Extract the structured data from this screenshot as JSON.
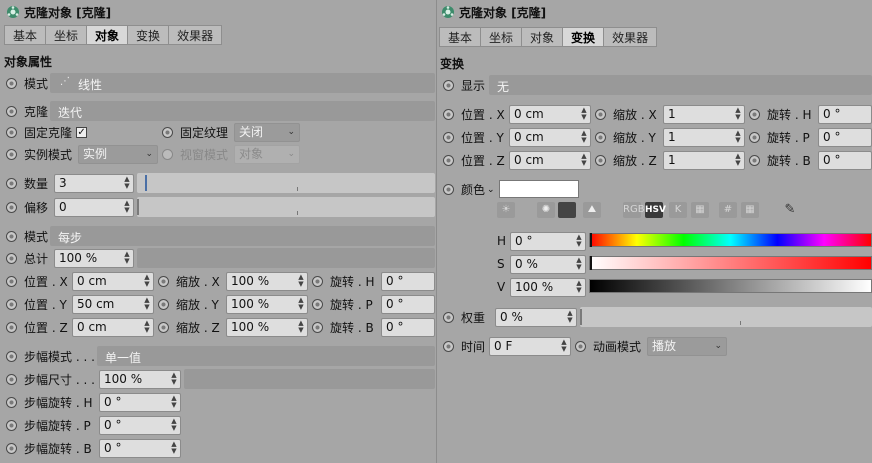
{
  "left": {
    "title": "克隆对象 [克隆]",
    "tabs": [
      "基本",
      "坐标",
      "对象",
      "变换",
      "效果器"
    ],
    "active_tab": "对象",
    "section": "对象属性",
    "mode_label": "模式",
    "mode_value": "线性",
    "clone_label": "克隆",
    "clone_value": "迭代",
    "fix_clone_label": "固定克隆",
    "fix_texture_label": "固定纹理",
    "fix_texture_value": "关闭",
    "instance_mode_label": "实例模式",
    "instance_mode_value": "实例",
    "viewport_mode_label": "视窗模式",
    "viewport_mode_value": "对象",
    "count_label": "数量",
    "count_value": "3",
    "offset_label": "偏移",
    "offset_value": "0",
    "mode2_label": "模式",
    "mode2_value": "每步",
    "total_label": "总计",
    "total_value": "100 %",
    "pos_x_label": "位置 . X",
    "pos_x_value": "0 cm",
    "pos_y_label": "位置 . Y",
    "pos_y_value": "50 cm",
    "pos_z_label": "位置 . Z",
    "pos_z_value": "0 cm",
    "scale_x_label": "缩放 . X",
    "scale_x_value": "100 %",
    "scale_y_label": "缩放 . Y",
    "scale_y_value": "100 %",
    "scale_z_label": "缩放 . Z",
    "scale_z_value": "100 %",
    "rot_h_label": "旋转 . H",
    "rot_h_value": "0 °",
    "rot_p_label": "旋转 . P",
    "rot_p_value": "0 °",
    "rot_b_label": "旋转 . B",
    "rot_b_value": "0 °",
    "step_mode_label": "步幅模式 . . .",
    "step_mode_value": "单一值",
    "step_size_label": "步幅尺寸 . . .",
    "step_size_value": "100 %",
    "step_rot_h_label": "步幅旋转 . H",
    "step_rot_h_value": "0 °",
    "step_rot_p_label": "步幅旋转 . P",
    "step_rot_p_value": "0 °",
    "step_rot_b_label": "步幅旋转 . B",
    "step_rot_b_value": "0 °"
  },
  "right": {
    "title": "克隆对象 [克隆]",
    "tabs": [
      "基本",
      "坐标",
      "对象",
      "变换",
      "效果器"
    ],
    "active_tab": "变换",
    "section": "变换",
    "display_label": "显示",
    "display_value": "无",
    "pos_x_label": "位置 . X",
    "pos_x_value": "0 cm",
    "pos_y_label": "位置 . Y",
    "pos_y_value": "0 cm",
    "pos_z_label": "位置 . Z",
    "pos_z_value": "0 cm",
    "scale_x_label": "缩放 . X",
    "scale_x_value": "1",
    "scale_y_label": "缩放 . Y",
    "scale_y_value": "1",
    "scale_z_label": "缩放 . Z",
    "scale_z_value": "1",
    "rot_h_label": "旋转 . H",
    "rot_h_value": "0 °",
    "rot_p_label": "旋转 . P",
    "rot_p_value": "0 °",
    "rot_b_label": "旋转 . B",
    "rot_b_value": "0 °",
    "color_label": "颜色",
    "color_value": "#ffffff",
    "picker_buttons": [
      "RGB",
      "HSV",
      "K",
      "▦",
      "#",
      "▦"
    ],
    "h_label": "H",
    "h_value": "0 °",
    "s_label": "S",
    "s_value": "0 %",
    "v_label": "V",
    "v_value": "100 %",
    "weight_label": "权重",
    "weight_value": "0 %",
    "time_label": "时间",
    "time_value": "0 F",
    "anim_mode_label": "动画模式",
    "anim_mode_value": "播放"
  }
}
